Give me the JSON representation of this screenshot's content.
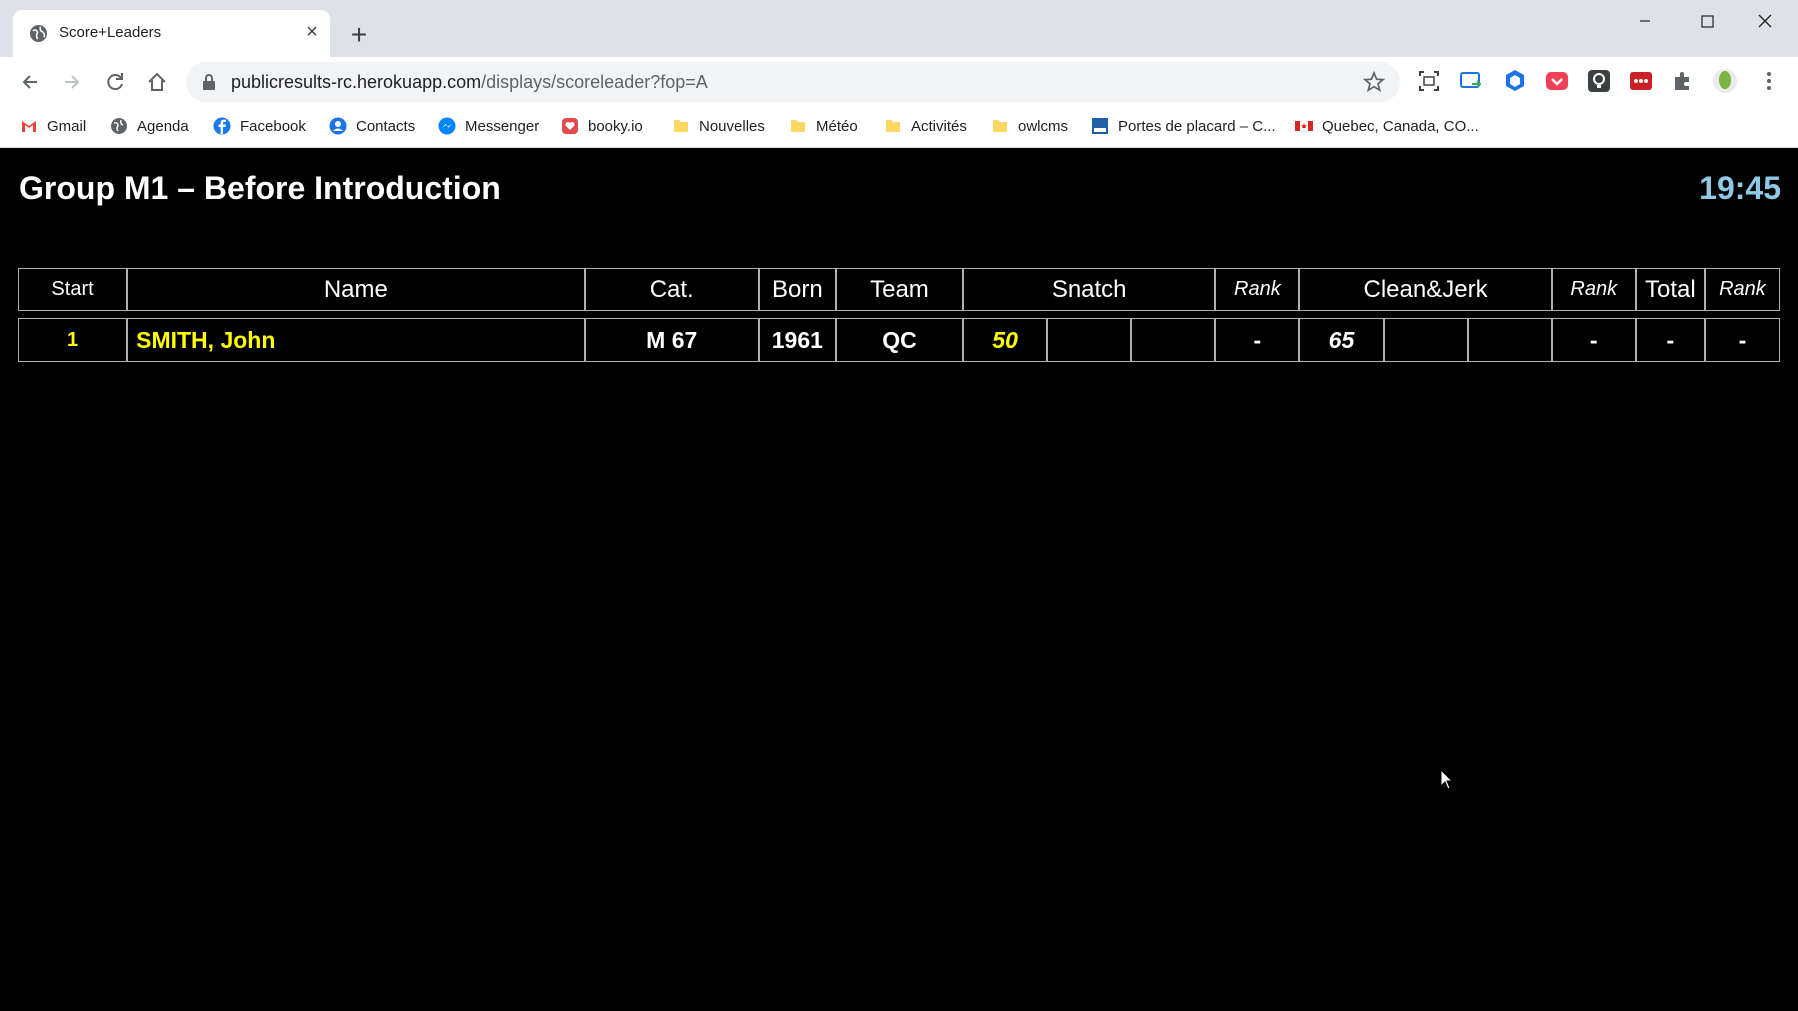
{
  "browser": {
    "tab_title": "Score+Leaders",
    "url_host": "publicresults-rc.herokuapp.com",
    "url_path": "/displays/scoreleader?fop=A",
    "bookmarks": [
      "Gmail",
      "Agenda",
      "Facebook",
      "Contacts",
      "Messenger",
      "booky.io",
      "Nouvelles",
      "Météo",
      "Activités",
      "owlcms",
      "Portes de placard – C...",
      "Quebec, Canada, CO..."
    ]
  },
  "scoreboard": {
    "title": "Group M1 – Before Introduction",
    "clock": "19:45",
    "headers": {
      "start": "Start",
      "name": "Name",
      "cat": "Cat.",
      "born": "Born",
      "team": "Team",
      "snatch": "Snatch",
      "snatch_rank": "Rank",
      "cj": "Clean&Jerk",
      "cj_rank": "Rank",
      "total": "Total",
      "total_rank": "Rank"
    },
    "rows": [
      {
        "start": "1",
        "name": "SMITH, John",
        "cat": "M 67",
        "born": "1961",
        "team": "QC",
        "snatch1": "50",
        "snatch2": "",
        "snatch3": "",
        "snatch_rank": "-",
        "cj1": "65",
        "cj2": "",
        "cj3": "",
        "cj_rank": "-",
        "total": "-",
        "total_rank": "-"
      }
    ]
  },
  "colors": {
    "background": "#000000",
    "current_athlete": "#ffff00",
    "clock": "#8ecae6"
  }
}
